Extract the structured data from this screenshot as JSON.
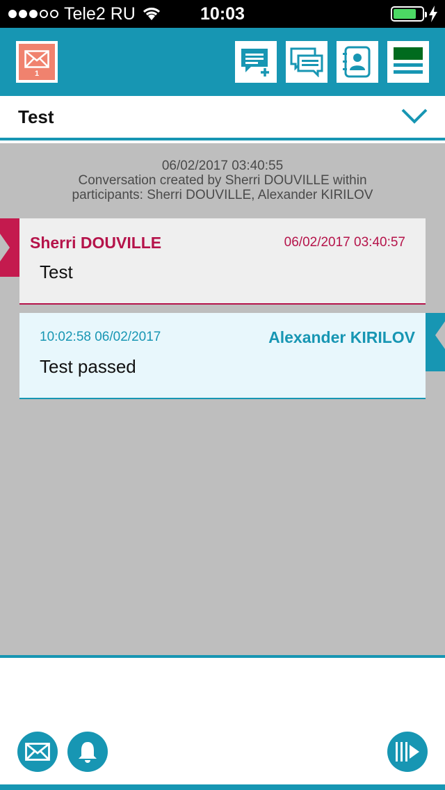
{
  "status_bar": {
    "carrier": "Tele2 RU",
    "time": "10:03",
    "battery_level": 0.8,
    "signal_bars": 3,
    "signal_total": 5
  },
  "header": {
    "mailbox_icon": "mail-icon",
    "mailbox_count": "1",
    "buttons": [
      {
        "icon": "new-chat-icon"
      },
      {
        "icon": "conversations-icon"
      },
      {
        "icon": "contacts-icon"
      },
      {
        "icon": "menu-icon"
      }
    ]
  },
  "conversation": {
    "title": "Test",
    "created_at": "06/02/2017 03:40:55",
    "created_line1": "Conversation created by Sherri DOUVILLE within",
    "created_line2": "participants: Sherri DOUVILLE, Alexander KIRILOV",
    "messages": [
      {
        "sender": "Sherri DOUVILLE",
        "time": "06/02/2017 03:40:57",
        "text": "Test",
        "direction": "incoming",
        "color": "#b5134a"
      },
      {
        "sender": "Alexander KIRILOV",
        "time": "10:02:58 06/02/2017",
        "text": "Test passed",
        "direction": "outgoing",
        "color": "#1796b3"
      }
    ]
  },
  "footer": {
    "buttons": [
      {
        "icon": "mail-icon"
      },
      {
        "icon": "bell-icon"
      },
      {
        "icon": "send-icon"
      }
    ]
  },
  "colors": {
    "accent": "#1796b3",
    "incoming": "#b5134a",
    "background": "#bebebe",
    "mailbox_tile": "#f0826e"
  }
}
